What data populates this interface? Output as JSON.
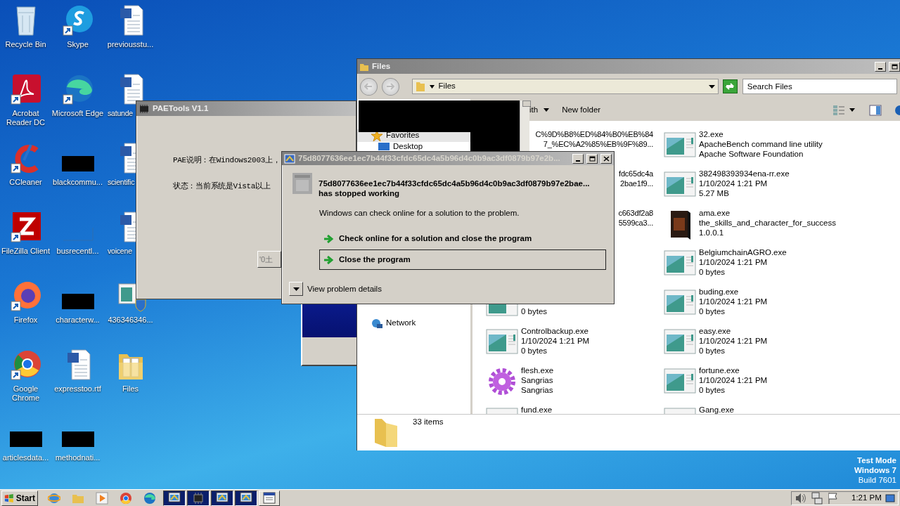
{
  "desktop_icons": [
    {
      "label": "Recycle Bin",
      "kind": "recycle",
      "shortcut": false,
      "cut": false
    },
    {
      "label": "Acrobat\nReader DC",
      "kind": "acrobat",
      "shortcut": true,
      "cut": false
    },
    {
      "label": "CCleaner",
      "kind": "ccleaner",
      "shortcut": true,
      "cut": false
    },
    {
      "label": "FileZilla Client",
      "kind": "filezilla",
      "shortcut": true,
      "cut": false
    },
    {
      "label": "Firefox",
      "kind": "firefox",
      "shortcut": true,
      "cut": false
    },
    {
      "label": "Google\nChrome",
      "kind": "chrome",
      "shortcut": true,
      "cut": false
    },
    {
      "label": "articlesdata...",
      "kind": "black",
      "shortcut": false,
      "cut": false
    },
    {
      "label": "Skype",
      "kind": "skype",
      "shortcut": true,
      "cut": false
    },
    {
      "label": "Microsoft Edge",
      "kind": "edge",
      "shortcut": true,
      "cut": false
    },
    {
      "label": "blackcommu...",
      "kind": "black",
      "shortcut": false,
      "cut": false
    },
    {
      "label": "busrecentl...",
      "kind": "blank",
      "shortcut": false,
      "cut": false
    },
    {
      "label": "characterw...",
      "kind": "black",
      "shortcut": false,
      "cut": false
    },
    {
      "label": "expresstoo.rtf",
      "kind": "word",
      "shortcut": false,
      "cut": false
    },
    {
      "label": "methodnati...",
      "kind": "black",
      "shortcut": false,
      "cut": false
    },
    {
      "label": "previousstu...",
      "kind": "word",
      "shortcut": false,
      "cut": false
    },
    {
      "label": "satunde",
      "kind": "word",
      "shortcut": false,
      "cut": true
    },
    {
      "label": "scientific",
      "kind": "word",
      "shortcut": false,
      "cut": true
    },
    {
      "label": "voicene",
      "kind": "word",
      "shortcut": false,
      "cut": true
    },
    {
      "label": "436346346...",
      "kind": "setup",
      "shortcut": false,
      "cut": false
    },
    {
      "label": "Files",
      "kind": "folder",
      "shortcut": false,
      "cut": false
    }
  ],
  "desktop_notice": [
    {
      "text": "Test Mode",
      "bold": true
    },
    {
      "text": "Windows 7",
      "bold": true
    },
    {
      "text": "Build 7601",
      "bold": false
    }
  ],
  "paetools": {
    "title": "PAETools V1.1",
    "lines": [
      "PAE说明：在Windows2003上，",
      "状态：当前系统是Vista以上"
    ],
    "button": "'0土"
  },
  "explorer": {
    "title": "Files",
    "address": "Files",
    "search_placeholder": "Search Files",
    "toolbar": [
      "ith",
      "New folder"
    ],
    "nav": [
      {
        "label": "Favorites",
        "kind": "favorites",
        "selected": true
      },
      {
        "label": "Desktop",
        "kind": "desktop",
        "selected": false
      },
      {
        "label": "Network",
        "kind": "network",
        "selected": false
      }
    ],
    "files_left": [
      {
        "kind": "clipped",
        "lines": [
          "C%9D%B8%ED%84%B0%EB%84",
          "7_%EC%A2%85%EB%9F%89..."
        ]
      },
      {
        "kind": "clipped",
        "lines": [
          "fdc65dc4a",
          "2bae1f9..."
        ]
      },
      {
        "kind": "clipped",
        "lines": [
          "c663df2a8",
          "5599ca3..."
        ]
      },
      {
        "kind": "tail",
        "lines": [
          "0 bytes"
        ]
      },
      {
        "kind": "app",
        "lines": [
          "Controlbackup.exe",
          "1/10/2024 1:21 PM",
          "0 bytes"
        ]
      },
      {
        "kind": "gear",
        "lines": [
          "flesh.exe",
          "Sangrias",
          "Sangrias"
        ]
      },
      {
        "kind": "cut",
        "lines": [
          "fund.exe"
        ]
      }
    ],
    "files_right": [
      {
        "kind": "app",
        "lines": [
          "32.exe",
          "ApacheBench command line utility",
          "Apache Software Foundation"
        ]
      },
      {
        "kind": "app",
        "lines": [
          "382498393934ena-rr.exe",
          "1/10/2024 1:21 PM",
          "5.27 MB"
        ]
      },
      {
        "kind": "box",
        "lines": [
          "ama.exe",
          "the_skills_and_character_for_success",
          "1.0.0.1"
        ]
      },
      {
        "kind": "app",
        "lines": [
          "BelgiumchainAGRO.exe",
          "1/10/2024 1:21 PM",
          "0 bytes"
        ]
      },
      {
        "kind": "app",
        "lines": [
          "buding.exe",
          "1/10/2024 1:21 PM",
          "0 bytes"
        ]
      },
      {
        "kind": "app",
        "lines": [
          "easy.exe",
          "1/10/2024 1:21 PM",
          "0 bytes"
        ]
      },
      {
        "kind": "app",
        "lines": [
          "fortune.exe",
          "1/10/2024 1:21 PM",
          "0 bytes"
        ]
      },
      {
        "kind": "cut",
        "lines": [
          "Gang.exe"
        ]
      }
    ],
    "status": "33 items"
  },
  "error_dialog": {
    "title": "75d8077636ee1ec7b44f33cfdc65dc4a5b96d4c0b9ac3df0879b97e2b...",
    "app_name": "75d8077636ee1ec7b44f33cfdc65dc4a5b96d4c0b9ac3df0879b97e2bae...",
    "headline": "has stopped working",
    "message": "Windows can check online for a solution to the problem.",
    "options": [
      {
        "label": "Check online for a solution and close the program",
        "selected": false
      },
      {
        "label": "Close the program",
        "selected": true
      }
    ],
    "details": "View problem details"
  },
  "taskbar": {
    "start": "Start",
    "tasks": [
      {
        "kind": "window",
        "highlighted": true
      },
      {
        "kind": "chip",
        "highlighted": true
      },
      {
        "kind": "window",
        "highlighted": true
      },
      {
        "kind": "window",
        "highlighted": true
      },
      {
        "kind": "dialog",
        "highlighted": false
      }
    ],
    "clock": "1:21 PM"
  }
}
